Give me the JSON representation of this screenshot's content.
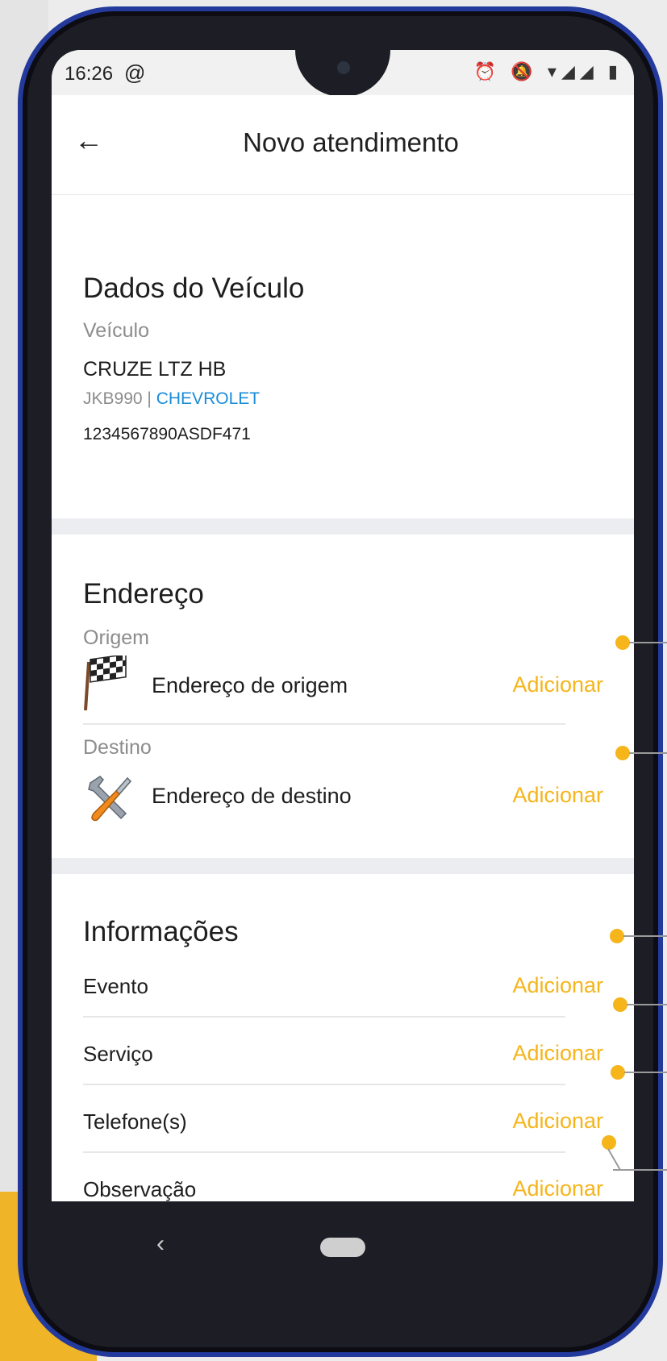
{
  "status": {
    "time": "16:26",
    "at_icon": "@",
    "icons": "⏰ 🔕 ▾◢◢ ▮"
  },
  "appbar": {
    "back_icon": "←",
    "title": "Novo atendimento"
  },
  "vehicle": {
    "section_title": "Dados do Veículo",
    "label": "Veículo",
    "model": "CRUZE LTZ HB",
    "plate": "JKB990",
    "separator": "|",
    "brand": "CHEVROLET",
    "chassis": "1234567890ASDF471"
  },
  "address": {
    "section_title": "Endereço",
    "origin_label": "Origem",
    "origin_text": "Endereço de origem",
    "origin_action": "Adicionar",
    "destination_label": "Destino",
    "destination_text": "Endereço de destino",
    "destination_action": "Adicionar"
  },
  "info": {
    "section_title": "Informações",
    "rows": [
      {
        "label": "Evento",
        "action": "Adicionar"
      },
      {
        "label": "Serviço",
        "action": "Adicionar"
      },
      {
        "label": "Telefone(s)",
        "action": "Adicionar"
      },
      {
        "label": "Observação",
        "action": "Adicionar"
      }
    ]
  },
  "nav": {
    "back_icon": "‹"
  },
  "colors": {
    "accent": "#f5b51b",
    "brand_link": "#1a8cd8",
    "phone_frame": "#233a9c"
  }
}
